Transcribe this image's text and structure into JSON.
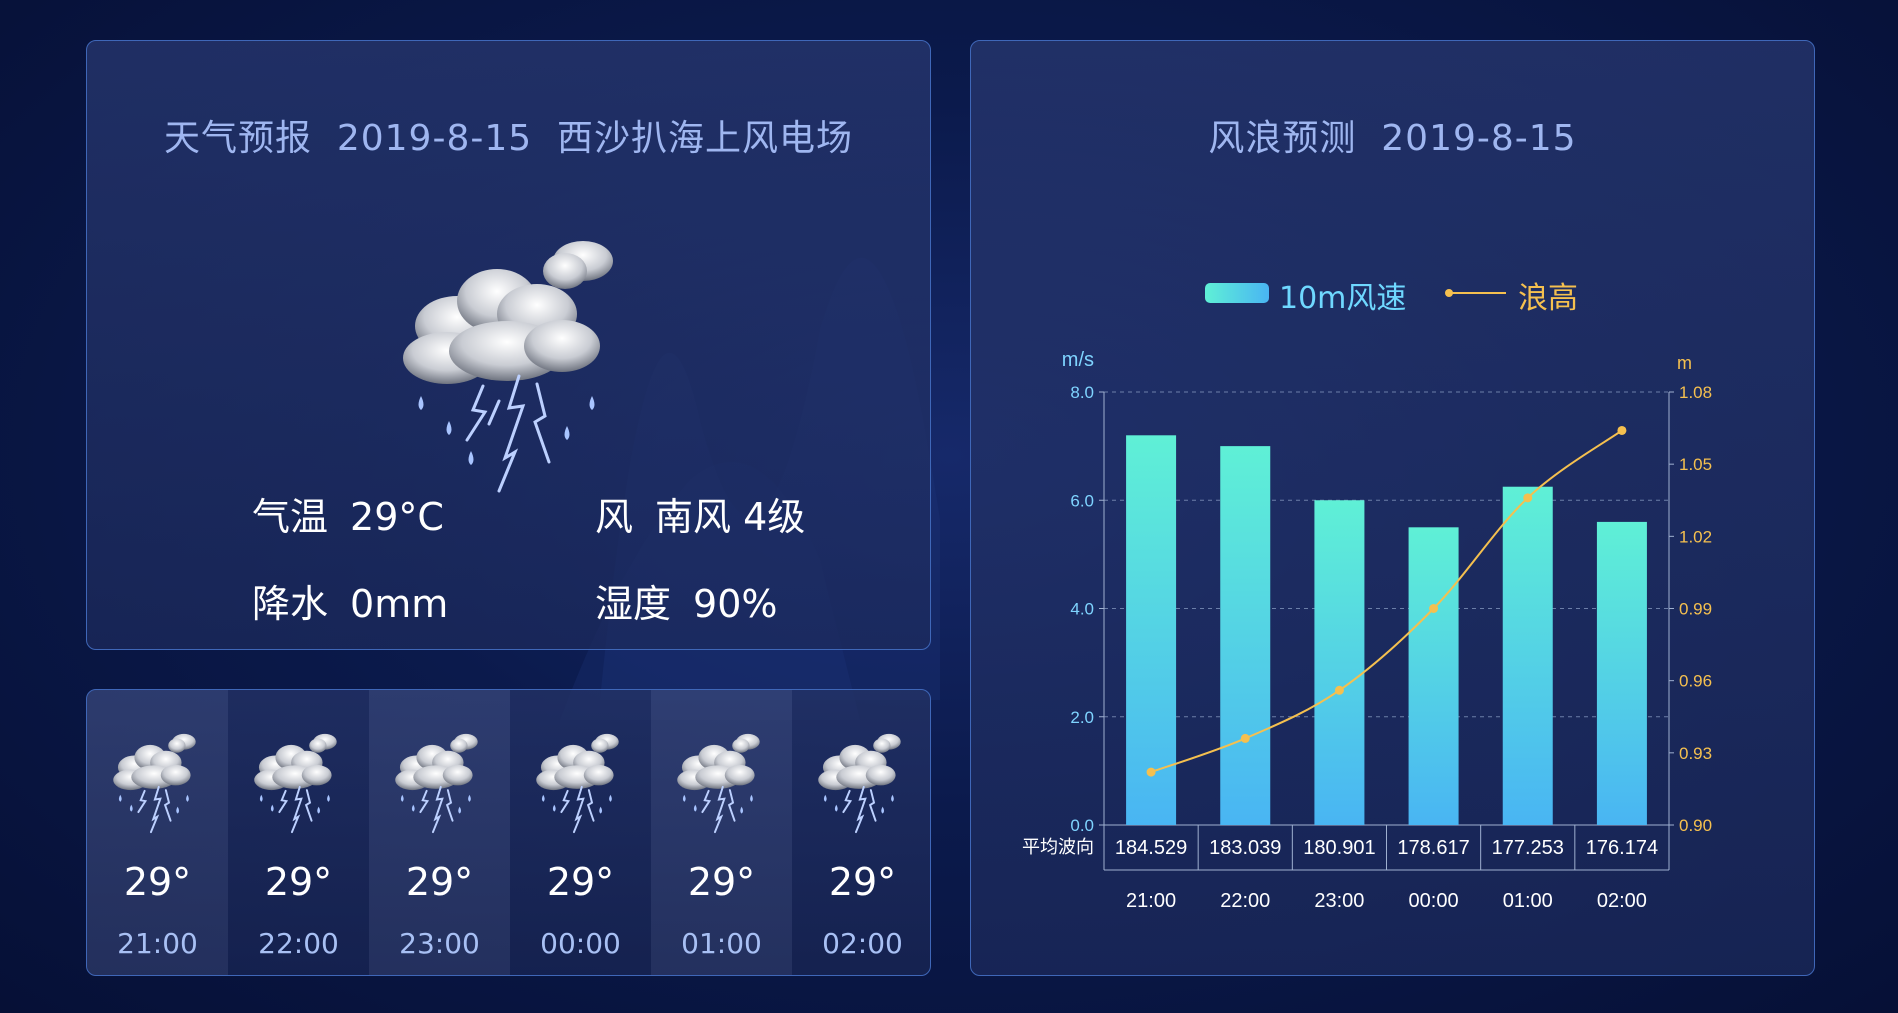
{
  "weather": {
    "title": "天气预报  2019-8-15  西沙扒海上风电场",
    "icon": "thunderstorm-icon",
    "temperature_label": "气温",
    "temperature_value": "29°C",
    "wind_label": "风",
    "wind_value": "南风 4级",
    "precip_label": "降水",
    "precip_value": "0mm",
    "humidity_label": "湿度",
    "humidity_value": "90%"
  },
  "hourly": [
    {
      "temp": "29°",
      "time": "21:00",
      "icon": "thunderstorm-icon"
    },
    {
      "temp": "29°",
      "time": "22:00",
      "icon": "thunderstorm-icon"
    },
    {
      "temp": "29°",
      "time": "23:00",
      "icon": "thunderstorm-icon"
    },
    {
      "temp": "29°",
      "time": "00:00",
      "icon": "thunderstorm-icon"
    },
    {
      "temp": "29°",
      "time": "01:00",
      "icon": "thunderstorm-icon"
    },
    {
      "temp": "29°",
      "time": "02:00",
      "icon": "thunderstorm-icon"
    }
  ],
  "forecast": {
    "title": "风浪预测  2019-8-15",
    "legend_wind": "10m风速",
    "legend_wave": "浪高"
  },
  "colors": {
    "bar_top": "#5ff0d6",
    "bar_bottom": "#49b5f3",
    "wave_line": "#f5c04f",
    "left_axis": "#7fd4ff",
    "right_axis": "#f5c04f"
  },
  "chart_data": {
    "type": "bar",
    "categories": [
      "21:00",
      "22:00",
      "23:00",
      "00:00",
      "01:00",
      "02:00"
    ],
    "series": [
      {
        "name": "10m风速",
        "type": "bar",
        "axis": "left",
        "values": [
          7.2,
          7.0,
          6.0,
          5.5,
          6.25,
          5.6
        ]
      },
      {
        "name": "浪高",
        "type": "line",
        "axis": "right",
        "values": [
          0.922,
          0.936,
          0.956,
          0.99,
          1.036,
          1.064
        ]
      }
    ],
    "table_row_label": "平均波向",
    "table_values": [
      "184.529",
      "183.039",
      "180.901",
      "178.617",
      "177.253",
      "176.174"
    ],
    "y_left_unit": "m/s",
    "y_left_ticks": [
      "0.0",
      "2.0",
      "4.0",
      "6.0",
      "8.0"
    ],
    "ylim_left": [
      0,
      8
    ],
    "y_right_unit": "m",
    "y_right_ticks": [
      "0.90",
      "0.93",
      "0.96",
      "0.99",
      "1.02",
      "1.05",
      "1.08"
    ],
    "ylim_right": [
      0.9,
      1.08
    ],
    "grid": "dashed horizontal",
    "legend_position": "top-center"
  }
}
